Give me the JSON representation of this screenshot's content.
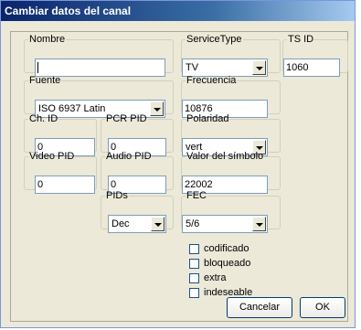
{
  "dialog": {
    "title": "Cambiar datos del canal"
  },
  "fields": {
    "nombre": {
      "label": "Nombre",
      "value": ""
    },
    "service_type": {
      "label": "ServiceType",
      "value": "TV"
    },
    "ts_id": {
      "label": "TS ID",
      "value": "1060"
    },
    "fuente": {
      "label": "Fuente",
      "value": "ISO 6937 Latin"
    },
    "frecuencia": {
      "label": "Frecuencia",
      "value": "10876"
    },
    "ch_id": {
      "label": "Ch. ID",
      "value": "0"
    },
    "pcr_pid": {
      "label": "PCR PID",
      "value": "0"
    },
    "polaridad": {
      "label": "Polaridad",
      "value": "vert"
    },
    "video_pid": {
      "label": "Video PID",
      "value": "0"
    },
    "audio_pid": {
      "label": "Audio PID",
      "value": "0"
    },
    "valor_simbolo": {
      "label": "Valor del símbolo",
      "value": "22002"
    },
    "pids": {
      "label": "PIDs",
      "value": "Dec"
    },
    "fec": {
      "label": "FEC",
      "value": "5/6"
    }
  },
  "checkboxes": [
    {
      "label": "codificado",
      "checked": false
    },
    {
      "label": "bloqueado",
      "checked": false
    },
    {
      "label": "extra",
      "checked": false
    },
    {
      "label": "indeseable",
      "checked": false
    }
  ],
  "buttons": {
    "cancel": "Cancelar",
    "ok": "OK"
  }
}
